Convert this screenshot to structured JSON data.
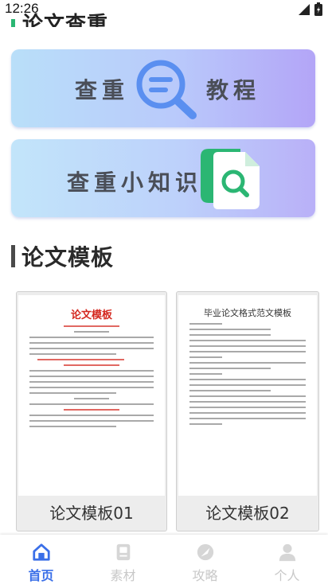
{
  "status_bar": {
    "time": "12:26"
  },
  "top_heading": {
    "text": "论文查重"
  },
  "banners": [
    {
      "left_text": "查重",
      "right_text": "教程"
    },
    {
      "text": "查重小知识"
    }
  ],
  "templates_section": {
    "title": "论文模板",
    "cards": [
      {
        "doc_title": "论文模板",
        "label": "论文模板01"
      },
      {
        "doc_title": "毕业论文格式范文模板",
        "label": "论文模板02"
      }
    ]
  },
  "bottom_nav": [
    {
      "label": "首页",
      "icon": "home-icon",
      "active": true
    },
    {
      "label": "素材",
      "icon": "material-icon",
      "active": false
    },
    {
      "label": "攻略",
      "icon": "guide-icon",
      "active": false
    },
    {
      "label": "个人",
      "icon": "person-icon",
      "active": false
    }
  ],
  "colors": {
    "accent": "#3a6fe8",
    "green": "#2bb673",
    "inactive": "#c8c8c8"
  }
}
